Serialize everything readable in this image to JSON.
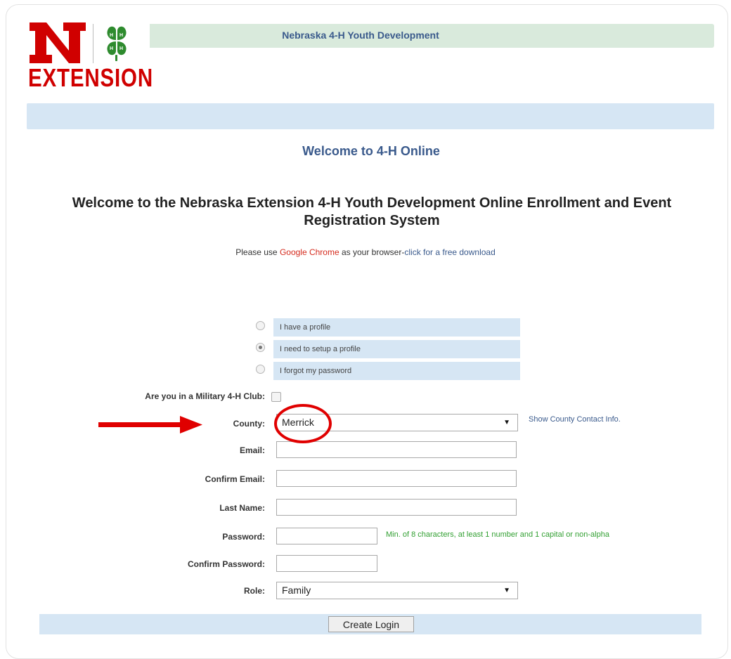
{
  "brand": {
    "logo_wordmark": "EXTENSION",
    "site_title": "Nebraska 4-H Youth Development",
    "red": "#d00000",
    "green": "#2e8b2e"
  },
  "welcome": {
    "subtitle": "Welcome to 4-H Online",
    "main_title": "Welcome to the Nebraska Extension 4-H Youth Development Online Enrollment and Event Registration System",
    "browser_note_prefix": "Please use ",
    "browser_note_link": "Google Chrome",
    "browser_note_middle": " as your browser-",
    "browser_note_download": "click for a free download"
  },
  "profile_options": [
    {
      "label": "I have a profile",
      "selected": false
    },
    {
      "label": "I need to setup a profile",
      "selected": true
    },
    {
      "label": "I forgot my password",
      "selected": false
    }
  ],
  "form": {
    "military_label": "Are you in a Military 4-H Club:",
    "military_checked": false,
    "county_label": "County:",
    "county_value": "Merrick",
    "county_contact_link": "Show County Contact Info.",
    "email_label": "Email:",
    "confirm_email_label": "Confirm Email:",
    "last_name_label": "Last Name:",
    "password_label": "Password:",
    "password_hint": "Min. of 8 characters, at least 1 number and 1 capital or non-alpha",
    "confirm_password_label": "Confirm Password:",
    "role_label": "Role:",
    "role_value": "Family",
    "submit_label": "Create Login"
  },
  "annotation": {
    "color": "#e00000"
  }
}
